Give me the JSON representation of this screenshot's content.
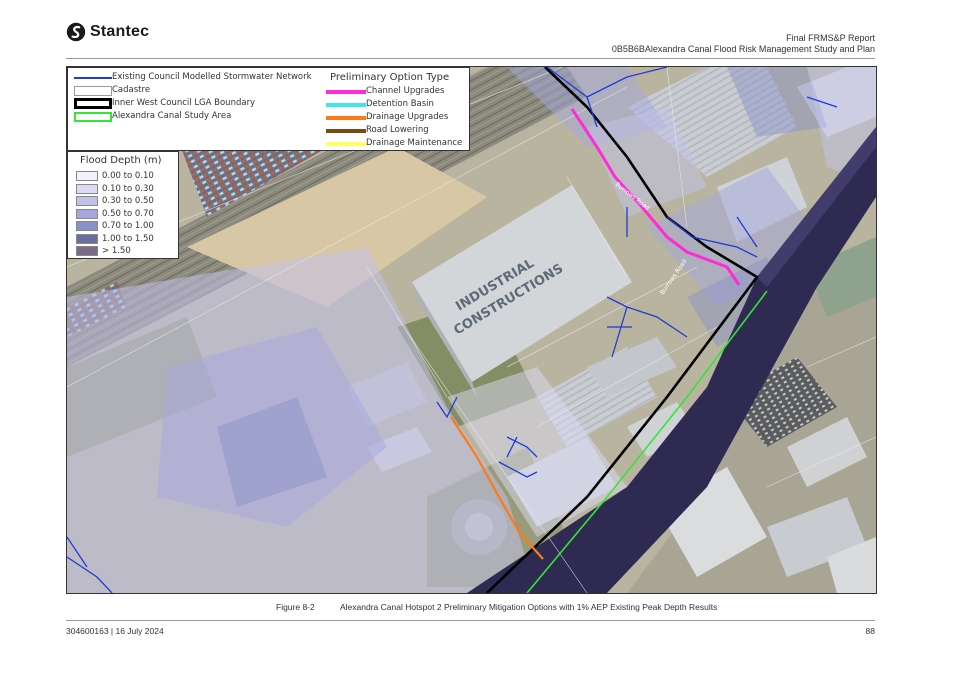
{
  "header": {
    "logo_text": "Stantec",
    "report_title": "Final FRMS&P Report",
    "report_subtitle": "0B5B6BAlexandra Canal Flood Risk Management Study and Plan"
  },
  "legend": {
    "network_items": [
      {
        "label": "Existing Council Modelled Stormwater Network",
        "color": "#1f3bd6"
      },
      {
        "label": "Cadastre",
        "color": "#9a9a9a"
      },
      {
        "label": "Inner West Council LGA Boundary",
        "color": "#000000"
      },
      {
        "label": "Alexandra Canal Study Area",
        "color": "#33e633"
      }
    ],
    "option_title": "Preliminary Option Type",
    "option_items": [
      {
        "label": "Channel Upgrades",
        "color": "#ff2bd6"
      },
      {
        "label": "Detention Basin",
        "color": "#3fe6ea"
      },
      {
        "label": "Drainage Upgrades",
        "color": "#ff7a14"
      },
      {
        "label": "Road Lowering",
        "color": "#7a4a14"
      },
      {
        "label": "Drainage Maintenance",
        "color": "#ffff66"
      }
    ],
    "depth_title": "Flood Depth (m)",
    "depth_items": [
      {
        "label": "0.00 to 0.10",
        "color": "#f4f1fb"
      },
      {
        "label": "0.10 to 0.30",
        "color": "#dcdaf3"
      },
      {
        "label": "0.30 to 0.50",
        "color": "#c2c1ea"
      },
      {
        "label": "0.50 to 0.70",
        "color": "#a6a8dd"
      },
      {
        "label": "0.70 to 1.00",
        "color": "#8890c8"
      },
      {
        "label": "1.00 to 1.50",
        "color": "#6a6f9f"
      },
      {
        "label": "> 1.50",
        "color": "#7a6a86"
      }
    ]
  },
  "map": {
    "road_label_1": "Burrows Road",
    "road_label_2": "Burrows Road",
    "roof_text_1": "INDUSTRIAL",
    "roof_text_2": "CONSTRUCTIONS"
  },
  "caption": {
    "figure_number": "Figure 8-2",
    "figure_title": "Alexandra Canal Hotspot 2 Preliminary Mitigation Options with 1% AEP Existing Peak Depth Results"
  },
  "footer": {
    "doc_ref": "304600163 | 16 July 2024",
    "page_number": "88"
  }
}
